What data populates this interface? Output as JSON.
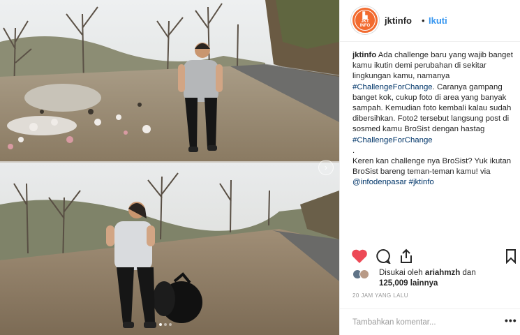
{
  "post": {
    "username": "jktinfo",
    "separator": "•",
    "follow_label": "Ikuti",
    "avatar": {
      "top_text": "JKT",
      "bottom_text": "INFO",
      "color": "#f26a2e",
      "icon": "city-skyline-icon"
    }
  },
  "caption": {
    "username": "jktinfo",
    "p1_a": " Ada challenge baru yang wajib banget kamu ikutin demi perubahan di sekitar lingkungan kamu, namanya ",
    "tag1": "#ChallengeForChange",
    "p1_b": ". Caranya gampang banget kok, cukup foto di area yang banyak sampah. Kemudian foto kembali kalau sudah dibersihkan. Foto2 tersebut langsung post di sosmed kamu BroSist dengan hastag ",
    "tag2": "#ChallengeForChange",
    "dot_line": ".",
    "p2": "Keren kan challenge nya BroSist? Yuk ikutan BroSist bareng teman-teman kamu! via ",
    "mention": "@infodenpasar",
    "space": " ",
    "tag3": "#jktinfo"
  },
  "likes": {
    "prefix": "Disukai oleh ",
    "user": "ariahmzh",
    "middle": " dan",
    "count": "125,009",
    "suffix": " lainnya"
  },
  "timestamp": "20 JAM YANG LALU",
  "comment": {
    "placeholder": "Tambahkan komentar...",
    "more_label": "•••"
  },
  "colors": {
    "like": "#ed4956",
    "link": "#003569",
    "follow": "#3897f0"
  }
}
